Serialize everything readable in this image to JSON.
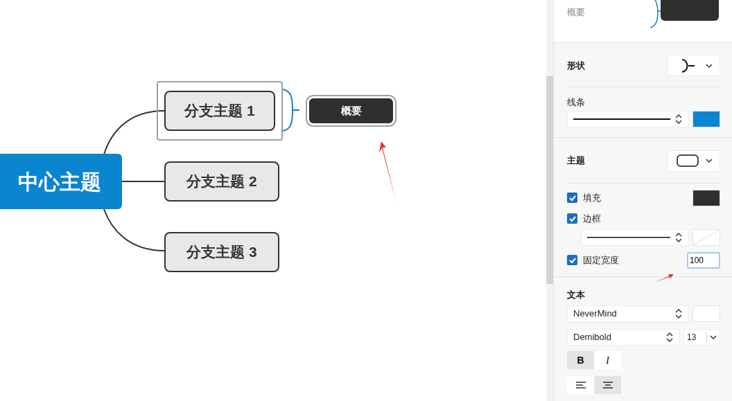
{
  "canvas": {
    "central_topic": "中心主题",
    "branches": [
      {
        "label": "分支主题 1",
        "selected": true
      },
      {
        "label": "分支主题 2",
        "selected": false
      },
      {
        "label": "分支主题 3",
        "selected": false
      }
    ],
    "summary": {
      "label": "概要",
      "selected": true
    }
  },
  "panel": {
    "header": {
      "label": "概要"
    },
    "shape": {
      "label": "形状"
    },
    "line": {
      "label": "线条",
      "color": "#0a85cf"
    },
    "topic": {
      "label": "主题"
    },
    "options": [
      {
        "kind": "fill",
        "label": "填充",
        "checked": true,
        "color": "#2f2f2f"
      },
      {
        "kind": "border",
        "label": "边框",
        "checked": true
      },
      {
        "kind": "width",
        "label": "固定宽度",
        "checked": true,
        "value": "100"
      }
    ],
    "text": {
      "label": "文本",
      "font": "NeverMind",
      "color": "#ffffff",
      "weight": "Demibold",
      "size": "13",
      "styles": [
        {
          "label": "B",
          "selected": true
        },
        {
          "label": "I",
          "selected": false
        }
      ],
      "aligns": [
        {
          "kind": "left",
          "selected": false
        },
        {
          "kind": "center",
          "selected": true
        }
      ]
    }
  }
}
